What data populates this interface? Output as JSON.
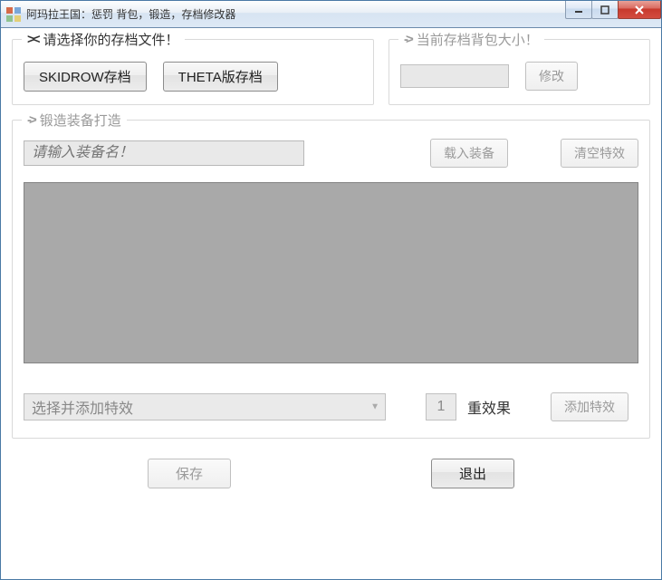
{
  "window": {
    "title": "阿玛拉王国：惩罚 背包，锻造，存档修改器"
  },
  "savefile": {
    "group_title": "请选择你的存档文件！",
    "skidrow_btn": "SKIDROW存档",
    "theta_btn": "THETA版存档"
  },
  "backpack": {
    "group_title": "当前存档背包大小！",
    "modify_btn": "修改"
  },
  "forge": {
    "group_title": "锻造装备打造",
    "equip_placeholder": "请输入装备名！",
    "load_btn": "载入装备",
    "clear_btn": "清空特效",
    "combo_placeholder": "选择并添加特效",
    "stack_value": "1",
    "stack_label": "重效果",
    "add_btn": "添加特效"
  },
  "footer": {
    "save_btn": "保存",
    "exit_btn": "退出"
  }
}
